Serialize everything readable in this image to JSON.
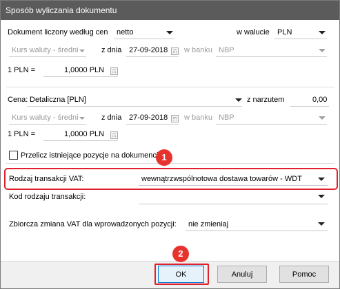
{
  "window": {
    "title": "Sposób wyliczania dokumentu"
  },
  "section1": {
    "doc_label": "Dokument liczony według cen",
    "doc_value": "netto",
    "currency_label": "w walucie",
    "currency_value": "PLN",
    "rate_type": "Kurs waluty - średni",
    "date_label": "z dnia",
    "date_value": "27-09-2018",
    "bank_label": "w banku",
    "bank_value": "NBP",
    "pln_label": "1 PLN =",
    "pln_value": "1,0000 PLN"
  },
  "section2": {
    "price_label": "Cena:",
    "price_value": "Detaliczna [PLN]",
    "markup_label": "z narzutem",
    "markup_value": "0,00",
    "rate_type": "Kurs waluty - średni",
    "date_label": "z dnia",
    "date_value": "27-09-2018",
    "bank_label": "w banku",
    "bank_value": "NBP",
    "pln_label": "1 PLN =",
    "pln_value": "1,0000 PLN",
    "recalc_label": "Przelicz istniejące pozycje na dokumencie",
    "recalc_checked": false
  },
  "vat": {
    "type_label": "Rodzaj transakcji VAT:",
    "type_value": "wewnątrzwspólnotowa dostawa towarów - WDT",
    "code_label": "Kod rodzaju transakcji:",
    "code_value": ""
  },
  "bulk": {
    "label": "Zbiorcza zmiana VAT dla wprowadzonych pozycji:",
    "value": "nie zmieniaj"
  },
  "buttons": {
    "ok": "OK",
    "cancel": "Anuluj",
    "help": "Pomoc"
  },
  "annotations": {
    "marker1": "1",
    "marker2": "2",
    "marker_color": "#e0202a"
  }
}
